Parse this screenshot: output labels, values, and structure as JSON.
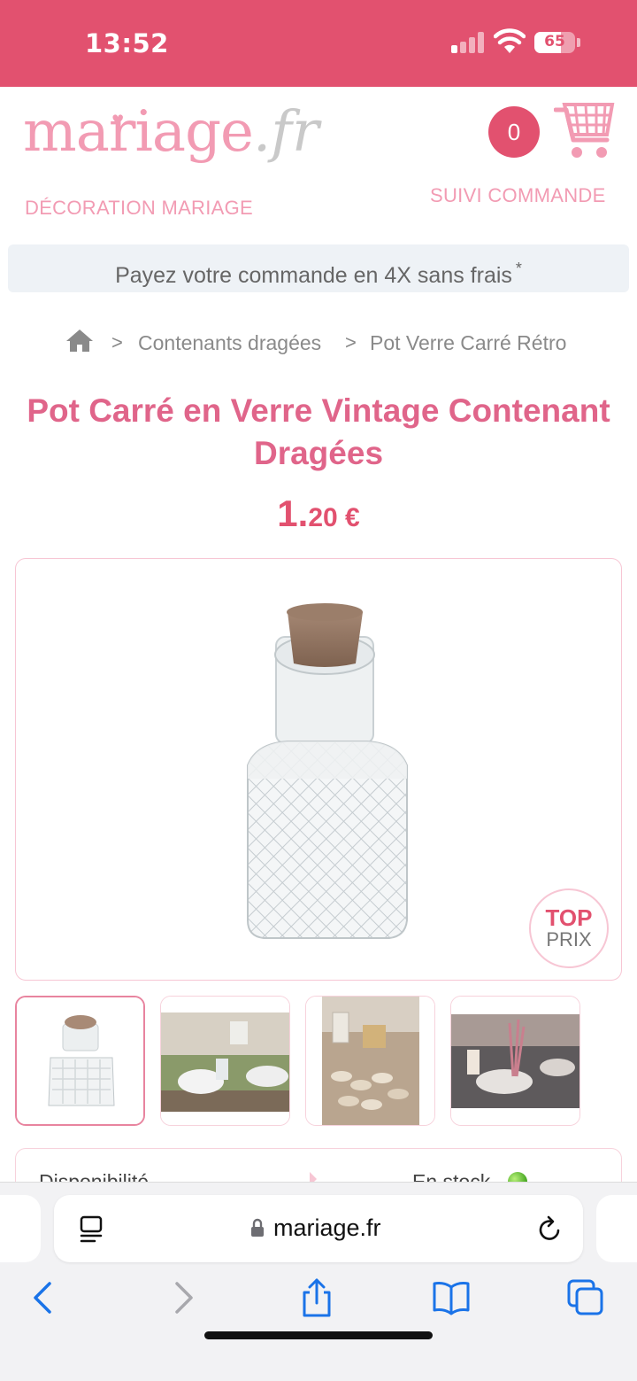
{
  "status_bar": {
    "time": "13:52",
    "battery": "65",
    "battery_level": 0.65,
    "signal_bars_on": 1
  },
  "header": {
    "logo_main": "mariage",
    "logo_tld": ".fr",
    "tagline": "DÉCORATION MARIAGE",
    "cart_count": "0",
    "order_tracking": "SUIVI COMMANDE"
  },
  "promo": {
    "text": "Payez votre commande en 4X sans frais",
    "mark": "*"
  },
  "breadcrumb": {
    "items": [
      "Contenants dragées",
      "Pot Verre Carré Rétro"
    ],
    "separator": ">"
  },
  "product": {
    "title": "Pot Carré en Verre Vintage Contenant Dragées",
    "price_int": "1.",
    "price_dec": "20 €",
    "badge_line1": "TOP",
    "badge_line2": "PRIX"
  },
  "availability": {
    "label": "Disponibilité",
    "value": "En stock"
  },
  "browser": {
    "url": "mariage.fr"
  },
  "colors": {
    "brand": "#e2516f",
    "logo_pink": "#f29bb3",
    "title_pink": "#e0658a",
    "ios_blue": "#1a73e8"
  },
  "icons": {
    "cart": "shopping-cart-icon",
    "home": "home-icon",
    "reader": "reader-mode-icon",
    "lock": "lock-icon",
    "reload": "reload-icon",
    "back": "back-icon",
    "forward": "forward-icon",
    "share": "share-icon",
    "bookmarks": "bookmarks-icon",
    "tabs": "tabs-icon"
  }
}
